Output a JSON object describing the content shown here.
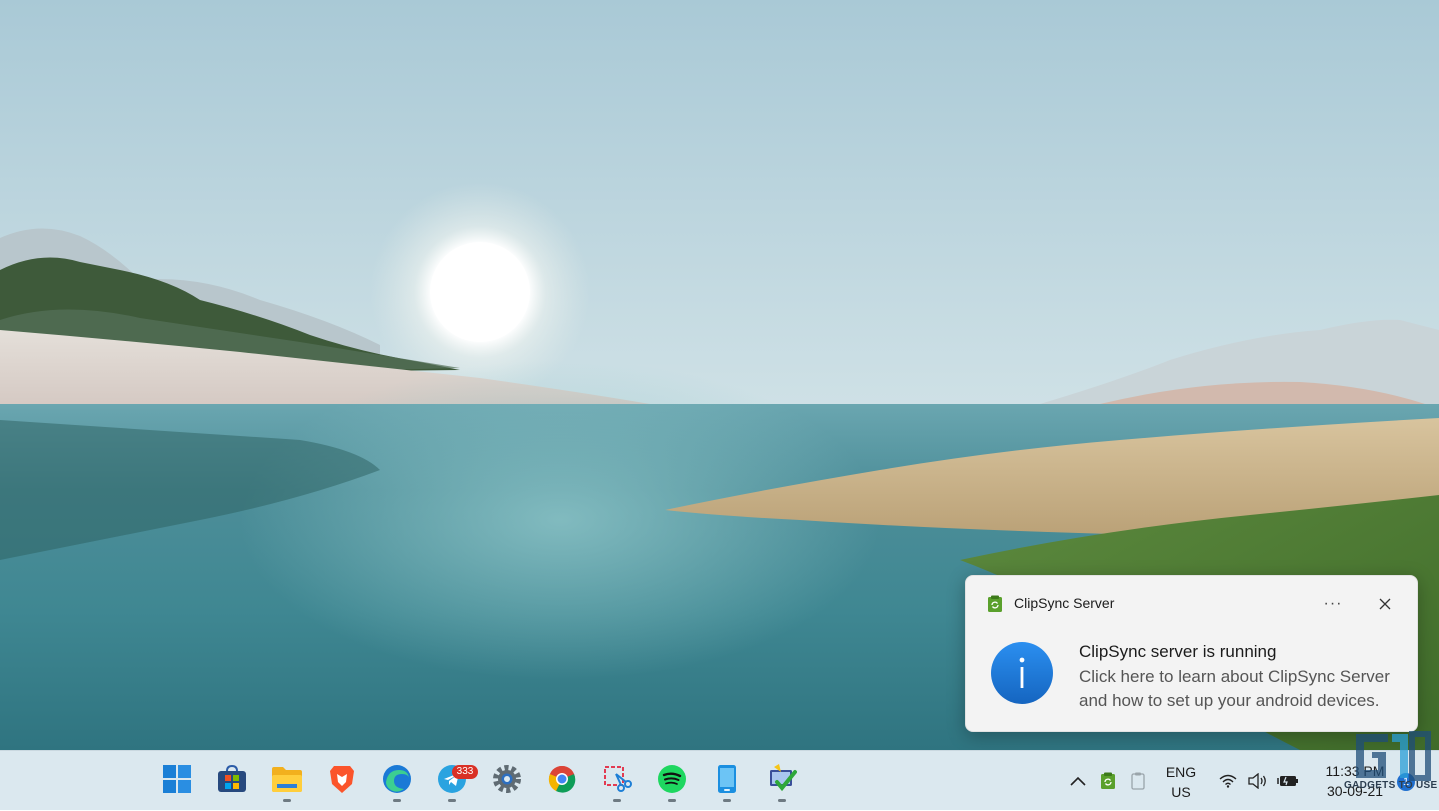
{
  "toast": {
    "app_name": "ClipSync Server",
    "more_label": "···",
    "title": "ClipSync server is running",
    "body": "Click here to learn about ClipSync Server and how to set up your android devices."
  },
  "taskbar": {
    "apps": [
      {
        "name": "start",
        "icon": "windows-logo-icon"
      },
      {
        "name": "microsoft-store",
        "icon": "store-icon"
      },
      {
        "name": "file-explorer",
        "icon": "folder-icon",
        "running": true
      },
      {
        "name": "brave",
        "icon": "brave-icon"
      },
      {
        "name": "edge",
        "icon": "edge-icon",
        "running": true
      },
      {
        "name": "telegram",
        "icon": "telegram-icon",
        "running": true,
        "badge": "333"
      },
      {
        "name": "settings",
        "icon": "gear-icon"
      },
      {
        "name": "chrome",
        "icon": "chrome-icon"
      },
      {
        "name": "snipping-tool",
        "icon": "snipping-icon",
        "running": true
      },
      {
        "name": "spotify",
        "icon": "spotify-icon",
        "running": true
      },
      {
        "name": "phone-link",
        "icon": "phone-icon",
        "running": true
      },
      {
        "name": "checker-app",
        "icon": "checkmark-app-icon",
        "running": true
      }
    ],
    "language": {
      "line1": "ENG",
      "line2": "US"
    },
    "clock": {
      "time": "11:33 PM",
      "date": "30-09-21"
    },
    "notification_count": "1"
  },
  "watermark": {
    "text": "GADGETS TO USE"
  },
  "colors": {
    "accent": "#1e7fd6",
    "taskbar": "#dbe8ef",
    "toast_bg": "#f3f3f3"
  }
}
